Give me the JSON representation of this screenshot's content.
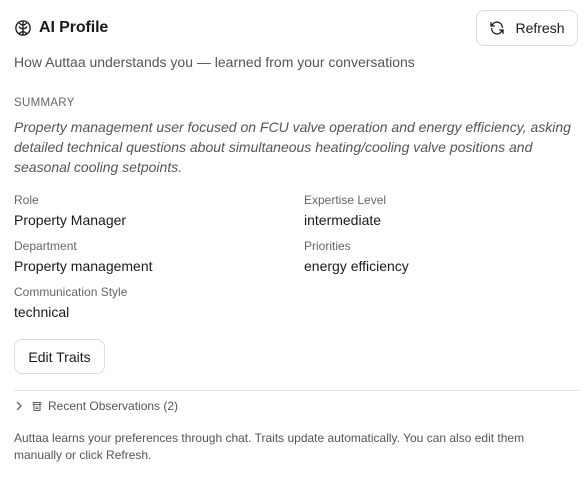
{
  "header": {
    "title": "AI Profile",
    "refresh_label": "Refresh"
  },
  "subtitle": "How Auttaa understands you — learned from your conversations",
  "summary": {
    "label": "SUMMARY",
    "text": "Property management user focused on FCU valve operation and energy efficiency, asking detailed technical questions about simultaneous heating/cooling valve positions and seasonal cooling setpoints."
  },
  "traits": {
    "role": {
      "label": "Role",
      "value": "Property Manager"
    },
    "expertise": {
      "label": "Expertise Level",
      "value": "intermediate"
    },
    "department": {
      "label": "Department",
      "value": "Property management"
    },
    "priorities": {
      "label": "Priorities",
      "value": "energy efficiency"
    },
    "communication": {
      "label": "Communication Style",
      "value": "technical"
    }
  },
  "edit_label": "Edit Traits",
  "observations_label": "Recent Observations (2)",
  "footer_text": "Auttaa learns your preferences through chat. Traits update automatically. You can also edit them manually or click Refresh.",
  "icons": {
    "title": "brain-icon",
    "refresh": "refresh-icon",
    "observations_toggle": "chevron-right-icon",
    "observations": "history-icon"
  }
}
